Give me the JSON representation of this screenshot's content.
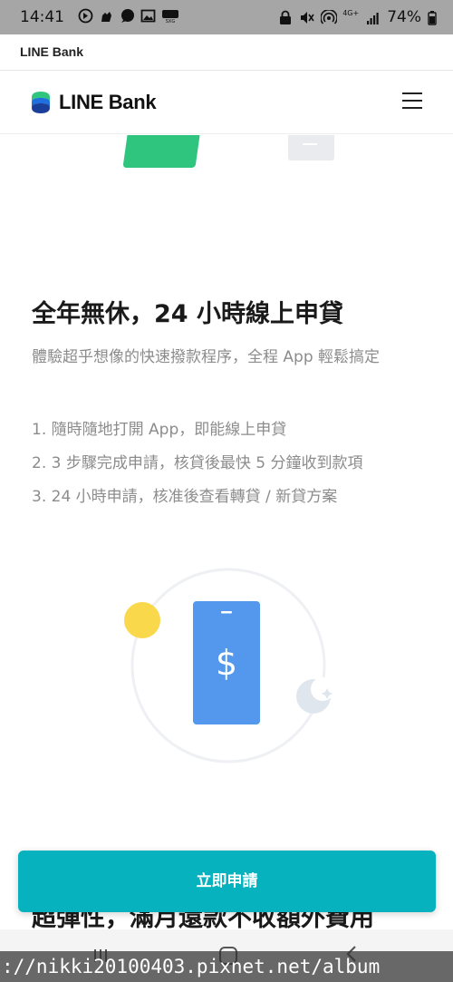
{
  "status_bar": {
    "time": "14:41",
    "battery": "74%",
    "network_label": "4G+",
    "left_icons": [
      "sync-icon",
      "hand-icon",
      "chat-icon",
      "image-icon",
      "sxg-icon"
    ],
    "right_icons": [
      "lock-icon",
      "mute-icon",
      "hotspot-icon",
      "network-icon",
      "signal-icon",
      "battery-icon"
    ]
  },
  "browser": {
    "title": "LINE Bank"
  },
  "header": {
    "logo_text": "LINE Bank",
    "menu_icon": "hamburger-icon"
  },
  "section": {
    "title": "全年無休，24 小時線上申貸",
    "description": "體驗超乎想像的快速撥款程序，全程 App 輕鬆搞定",
    "features": [
      "1. 隨時隨地打開 App，即能線上申貸",
      "2. 3 步驟完成申請，核貸後最快 5 分鐘收到款項",
      "3. 24 小時申請，核准後查看轉貸 / 新貸方案"
    ]
  },
  "next_section": {
    "title": "超彈性，滿月還款不收額外費用"
  },
  "cta": {
    "apply_label": "立即申請"
  },
  "illustration": {
    "phone_symbol": "$"
  },
  "watermark": {
    "text": "://nikki20100403.pixnet.net/album"
  },
  "colors": {
    "cta_teal": "#06b2bd",
    "phone_blue": "#5398ec",
    "sun_yellow": "#f9d84b",
    "brand_green": "#2fc57e"
  }
}
